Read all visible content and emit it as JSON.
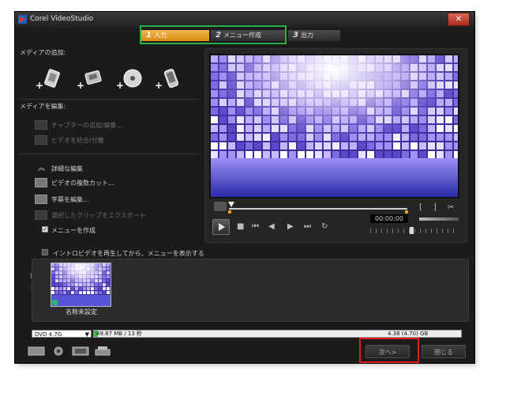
{
  "window": {
    "title": "Corel VideoStudio",
    "close_label": "✕"
  },
  "steps": [
    {
      "num": "1",
      "label": "入力",
      "active": true
    },
    {
      "num": "2",
      "label": "メニュー作成",
      "active": false
    },
    {
      "num": "3",
      "label": "出力",
      "active": false
    }
  ],
  "media_add": {
    "heading": "メディアの追加:",
    "icons": [
      "add-video-file-icon",
      "add-vr-icon",
      "add-disc-icon",
      "add-mobile-device-icon"
    ]
  },
  "media_edit": {
    "heading": "メディアを編集:",
    "chapter": "チャプターの追加/編集...",
    "combine": "ビデオを結合/分離"
  },
  "advanced": {
    "toggle_label": "詳細な編集",
    "multi_cut": "ビデオの複数カット...",
    "subtitle": "字幕を編集...",
    "apply_template": "選択したクリップをエクスポート",
    "create_menu": "メニューを作成",
    "create_menu_checked": true
  },
  "intro_option": {
    "label": "イントロビデオを再生してから、メニューを表示する",
    "checked": false
  },
  "player": {
    "timecode": "00:00:00"
  },
  "clips": [
    {
      "caption": "名称未設定"
    }
  ],
  "disc": {
    "type": "DVD 4.7G",
    "used": "49.87 MB / 13 秒",
    "total": "4.38 (4.70) GB",
    "used_fraction": 0.011
  },
  "buttons": {
    "next": "次へ>",
    "close": "閉じる"
  },
  "colors": {
    "accent": "#e3a02c",
    "highlight_green": "#27b14a",
    "highlight_red": "#e11c1c"
  }
}
